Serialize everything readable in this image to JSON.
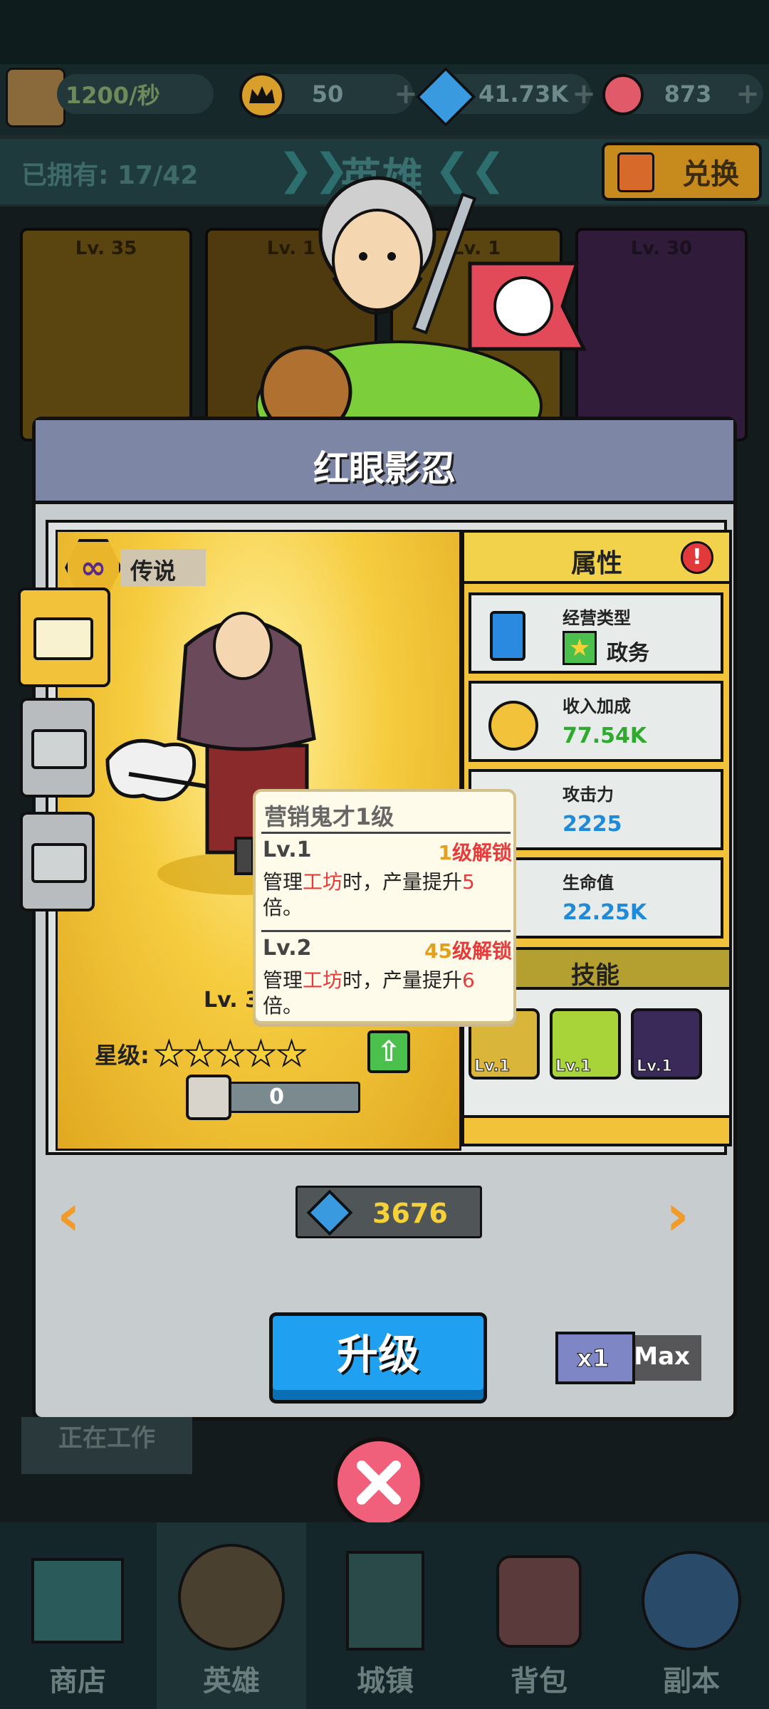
{
  "top": {
    "income_rate": "1200/秒",
    "crowns": "50",
    "gems": "41.73K",
    "hearts": "873"
  },
  "hero_header": {
    "owned_label": "已拥有: 17/42",
    "title": "英雄",
    "exchange_label": "兑换"
  },
  "bg_cards": [
    {
      "level": "Lv. 35"
    },
    {
      "level": "Lv. 1"
    },
    {
      "level": "Lv. 1"
    },
    {
      "level": "Lv. 30"
    }
  ],
  "modal": {
    "title": "红眼影忍",
    "rarity": "传说",
    "level": "Lv. 35",
    "star_label": "星级:",
    "stars": 5,
    "shard_count": "0",
    "cost": "3676",
    "upgrade_label": "升级",
    "multiplier_x1": "x1",
    "multiplier_max": "Max"
  },
  "attributes": {
    "title": "属性",
    "alert": "!",
    "items": [
      {
        "label": "经营类型",
        "value": "政务"
      },
      {
        "label": "收入加成",
        "value": "77.54K"
      },
      {
        "label": "攻击力",
        "value": "2225"
      },
      {
        "label": "生命值",
        "value": "22.25K"
      }
    ],
    "skills_title": "技能",
    "skills": [
      {
        "level": "Lv.1"
      },
      {
        "level": "Lv.1"
      },
      {
        "level": "Lv.1"
      }
    ]
  },
  "tooltip": {
    "title": "营销鬼才1级",
    "rows": [
      {
        "lv": "Lv.1",
        "unlock_num": "1",
        "unlock_text": "级解锁",
        "text_a": "管理",
        "text_b": "工坊",
        "text_c": "时，产量提升",
        "mult": "5",
        "text_d": "倍。"
      },
      {
        "lv": "Lv.2",
        "unlock_num": "45",
        "unlock_text": "级解锁",
        "text_a": "管理",
        "text_b": "工坊",
        "text_c": "时，产量提升",
        "mult": "6",
        "text_d": "倍。"
      }
    ]
  },
  "nav": [
    {
      "label": "商店"
    },
    {
      "label": "英雄"
    },
    {
      "label": "城镇"
    },
    {
      "label": "背包"
    },
    {
      "label": "副本"
    }
  ],
  "working_text": "正在工作"
}
